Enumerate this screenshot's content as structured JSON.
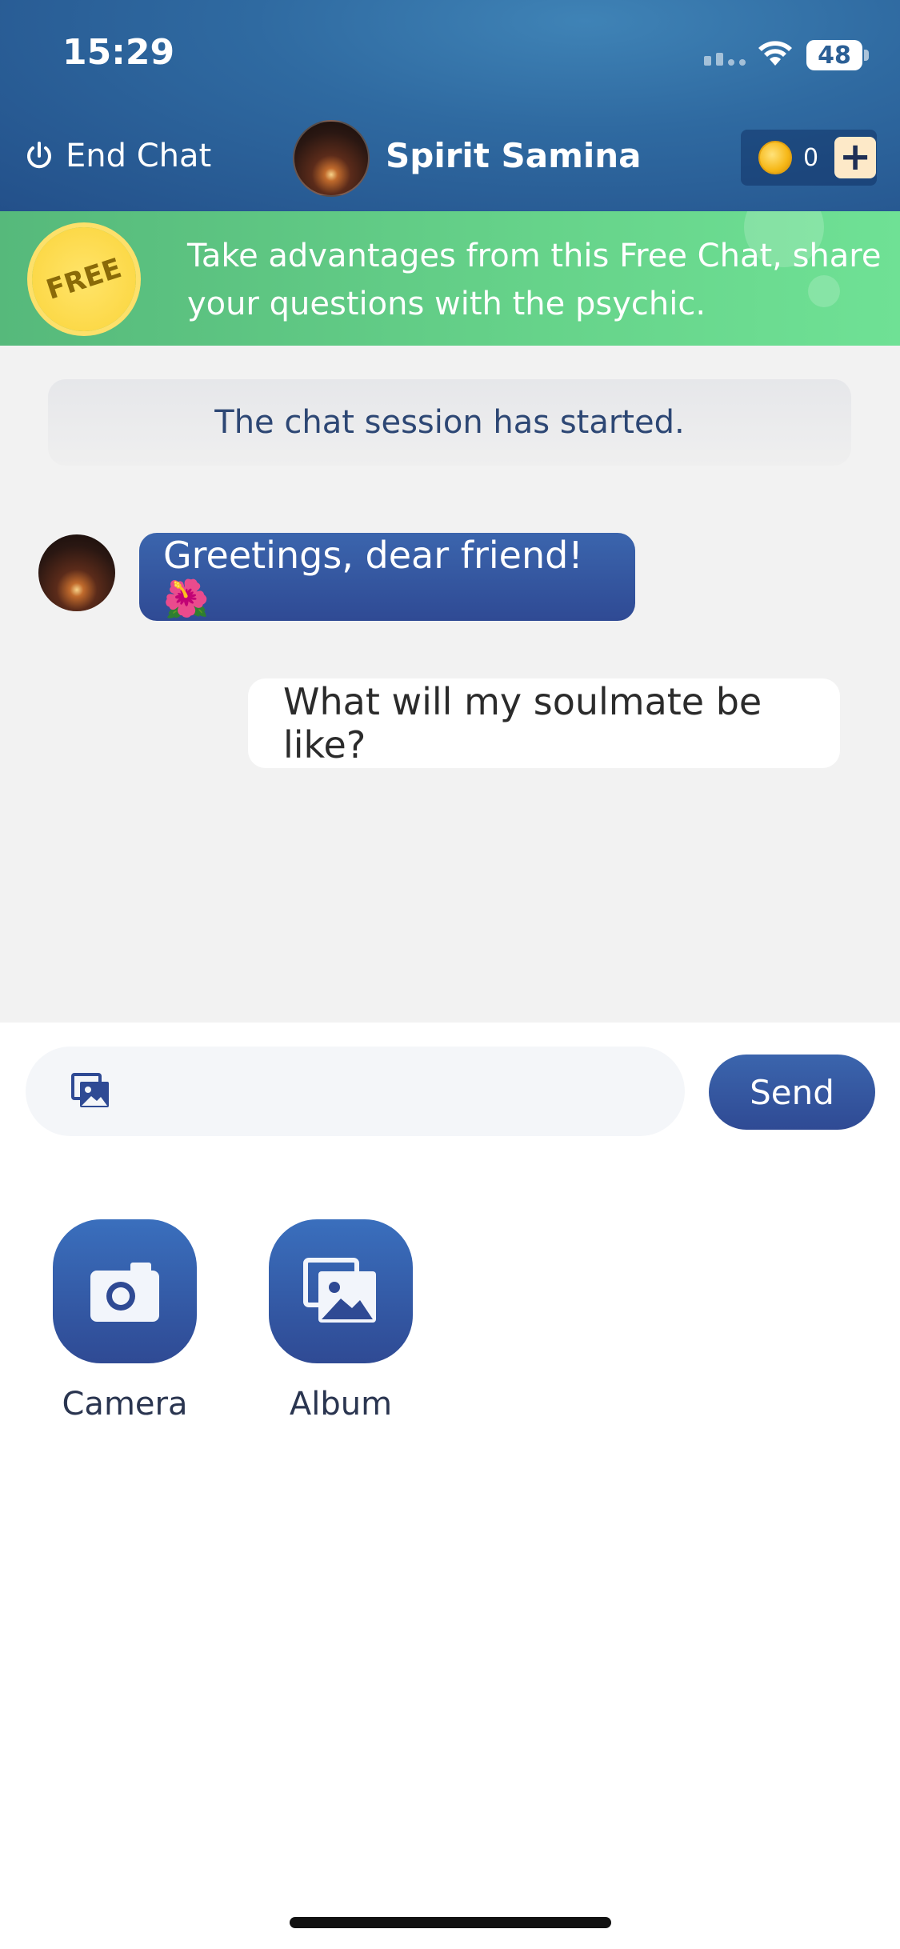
{
  "status_bar": {
    "time": "15:29",
    "battery": "48"
  },
  "header": {
    "end_chat_label": "End Chat",
    "psychic_name": "Spirit Samina",
    "coin_count": "0",
    "add_coins_label": "+"
  },
  "banner": {
    "badge": "FREE",
    "text": "Take advantages from this Free Chat, share your questions with the psychic."
  },
  "chat": {
    "session_notice": "The chat session has started.",
    "messages": [
      {
        "from": "psychic",
        "text": "Greetings, dear friend! 🌺"
      },
      {
        "from": "user",
        "text": "What will my soulmate be like?"
      }
    ]
  },
  "composer": {
    "send_label": "Send"
  },
  "attachments": [
    {
      "label": "Camera",
      "icon": "camera-icon"
    },
    {
      "label": "Album",
      "icon": "album-icon"
    }
  ],
  "colors": {
    "header": "#2f6aa1",
    "banner": "#66d38a",
    "accent": "#2f4a94",
    "chat_bg": "#f2f2f2"
  }
}
